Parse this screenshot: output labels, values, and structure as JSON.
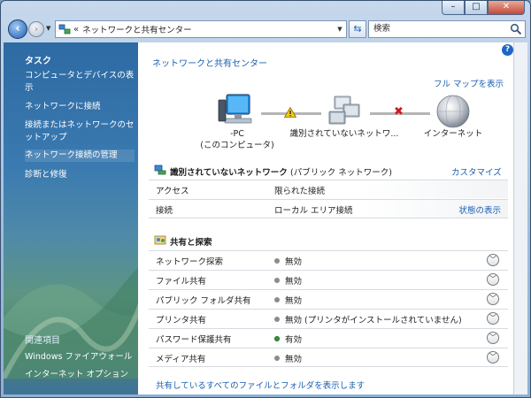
{
  "window": {
    "minimize_glyph": "–",
    "maximize_glyph": "□",
    "close_glyph": "✕"
  },
  "address": {
    "breadcrumb_chevron": "«",
    "path": "ネットワークと共有センター",
    "search_placeholder": "検索"
  },
  "sidebar": {
    "tasks_heading": "タスク",
    "tasks": [
      "コンピュータとデバイスの表示",
      "ネットワークに接続",
      "接続またはネットワークのセットアップ",
      "ネットワーク接続の管理",
      "診断と修復"
    ],
    "related_heading": "関連項目",
    "related": [
      "Windows ファイアウォール",
      "インターネット オプション"
    ]
  },
  "main": {
    "title": "ネットワークと共有センター",
    "full_map": "フル マップを表示",
    "map": {
      "pc_name": "-PC",
      "pc_sub": "(このコンピュータ)",
      "middle": "識別されていないネットワ...",
      "internet": "インターネット"
    },
    "network": {
      "name": "識別されていないネットワーク",
      "type": "(パブリック ネットワーク)",
      "customize": "カスタマイズ",
      "rows": [
        {
          "label": "アクセス",
          "value": "限られた接続",
          "action": ""
        },
        {
          "label": "接続",
          "value": "ローカル エリア接続",
          "action": "状態の表示"
        }
      ]
    },
    "sharing": {
      "heading": "共有と探索",
      "rows": [
        {
          "label": "ネットワーク探索",
          "value": "無効",
          "on": false
        },
        {
          "label": "ファイル共有",
          "value": "無効",
          "on": false
        },
        {
          "label": "パブリック フォルダ共有",
          "value": "無効",
          "on": false
        },
        {
          "label": "プリンタ共有",
          "value": "無効 (プリンタがインストールされていません)",
          "on": false
        },
        {
          "label": "パスワード保護共有",
          "value": "有効",
          "on": true
        },
        {
          "label": "メディア共有",
          "value": "無効",
          "on": false
        }
      ]
    },
    "bottom_link": "共有しているすべてのファイルとフォルダを表示します"
  },
  "colors": {
    "link": "#1a5fb4",
    "sidebar_top": "#2e6aa3",
    "enabled_dot": "#2f9a33",
    "disabled_dot": "#8c8c8c",
    "error_x": "#d8141b",
    "warning": "#f2c811"
  }
}
